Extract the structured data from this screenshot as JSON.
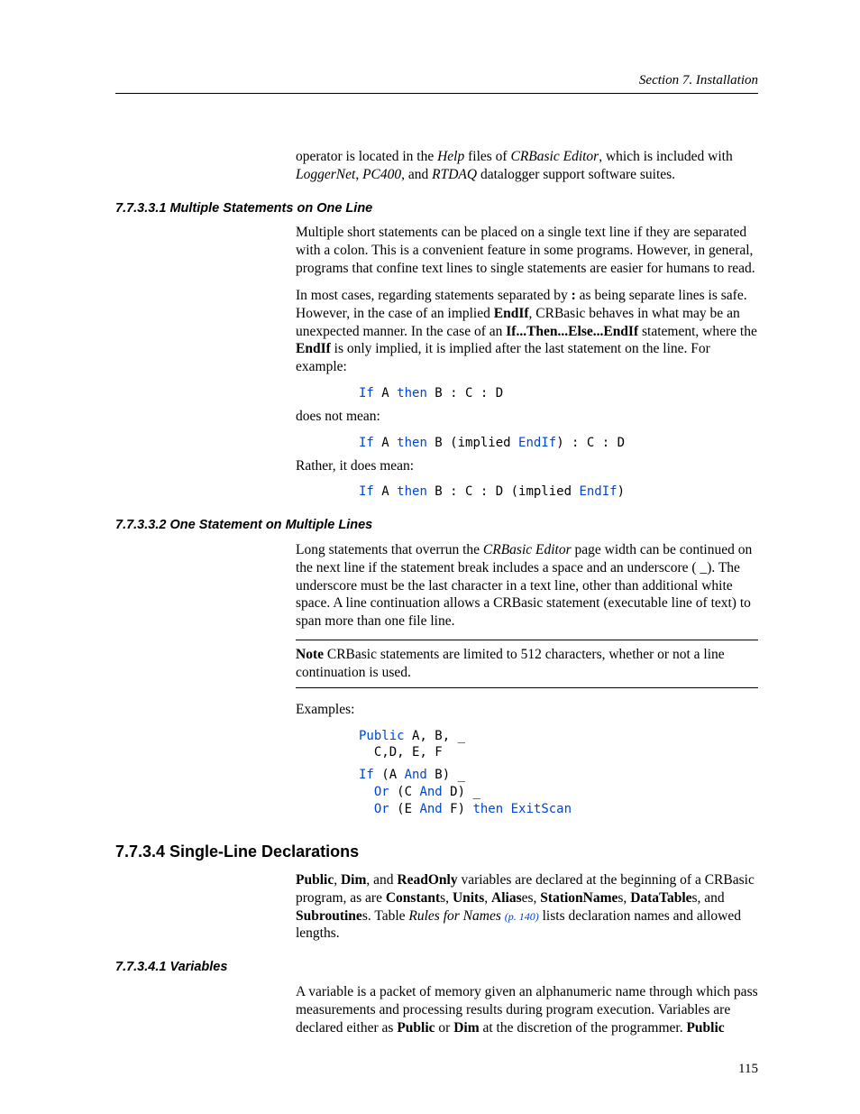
{
  "header": {
    "running": "Section 7.  Installation"
  },
  "intro": {
    "seg1": "operator is located in the ",
    "it1": "Help",
    "seg2": " files of ",
    "it2": "CRBasic Editor",
    "seg3": ", which is included with ",
    "it3": "LoggerNet",
    "seg4": ", ",
    "it4": "PC400",
    "seg5": ", and ",
    "it5": "RTDAQ",
    "seg6": " datalogger support software suites."
  },
  "s1": {
    "heading": "7.7.3.3.1 Multiple Statements on One Line",
    "p1": "Multiple short statements can be placed on a single text line if they are separated with a colon.  This is a convenient feature in some programs.  However, in general, programs that confine text lines to single statements are easier for humans to read.",
    "p2_a": "In most cases, regarding statements separated by ",
    "p2_colon": ":",
    "p2_b": " as being separate lines is safe.  However, in the case of an implied ",
    "p2_endif1": "EndIf",
    "p2_c": ", CRBasic behaves in what may be an unexpected manner.  In the case of an ",
    "p2_ifthen": "If...Then...Else...EndIf",
    "p2_d": " statement, where the ",
    "p2_endif2": "EndIf",
    "p2_e": " is only implied, it is implied after the last statement on the line.  For example:",
    "c1": {
      "kw1": "If",
      "t1": " A ",
      "kw2": "then",
      "t2": " B : C : D"
    },
    "p3": "does not mean:",
    "c2": {
      "kw1": "If",
      "t1": " A ",
      "kw2": "then",
      "t2": " B (implied ",
      "kw3": "EndIf",
      "t3": ") : C : D"
    },
    "p4": "Rather, it does mean:",
    "c3": {
      "kw1": "If",
      "t1": " A ",
      "kw2": "then",
      "t2": " B : C : D (implied ",
      "kw3": "EndIf",
      "t3": ")"
    }
  },
  "s2": {
    "heading": "7.7.3.3.2 One Statement on Multiple Lines",
    "p1_a": "Long statements that overrun the ",
    "p1_it": "CRBasic Editor",
    "p1_b": " page width can be continued on the next line if the statement break includes a space and an underscore ( _).  The underscore must be the last character in a text line, other than additional white space.  A line continuation allows a CRBasic statement (executable line of text) to span more than one file line.",
    "note_label": "Note",
    "note_body": "  CRBasic statements are limited to 512 characters, whether or not a line continuation is used.",
    "p2": "Examples:",
    "c1": {
      "kw1": "Public",
      "t1": " A, B, _",
      "t2": "  C,D, E, F"
    },
    "c2": {
      "kw1": "If",
      "t1": " (A ",
      "kw2": "And",
      "t2": " B) _",
      "t3": "  ",
      "kw3": "Or",
      "t4": " (C ",
      "kw4": "And",
      "t5": " D) _",
      "t6": "  ",
      "kw5": "Or",
      "t7": " (E ",
      "kw6": "And",
      "t8": " F) ",
      "kw7": "then",
      "t9": " ",
      "kw8": "ExitScan"
    }
  },
  "s3": {
    "heading": "7.7.3.4 Single-Line Declarations",
    "p1_a": "Public",
    "p1_b": ", ",
    "p1_c": "Dim",
    "p1_d": ", and ",
    "p1_e": "ReadOnly",
    "p1_f": " variables are declared at the beginning of a CRBasic program, as are ",
    "p1_g": "Constant",
    "p1_h": "s, ",
    "p1_i": "Units",
    "p1_j": ", ",
    "p1_k": "Alias",
    "p1_l": "es, ",
    "p1_m": "StationName",
    "p1_n": "s, ",
    "p1_o": "DataTable",
    "p1_p": "s, and ",
    "p1_q": "Subroutine",
    "p1_r": "s.  Table ",
    "p1_it": "Rules for Names ",
    "xref": "(p. 140)",
    "p1_s": " lists declaration names and allowed lengths."
  },
  "s4": {
    "heading": "7.7.3.4.1 Variables",
    "p1_a": "A variable is a packet of memory given an alphanumeric name through which pass measurements and processing results during program execution. Variables are declared either as ",
    "p1_b": "Public",
    "p1_c": " or ",
    "p1_d": "Dim",
    "p1_e": " at the discretion of the programmer. ",
    "p1_f": "Public"
  },
  "pagenum": "115"
}
